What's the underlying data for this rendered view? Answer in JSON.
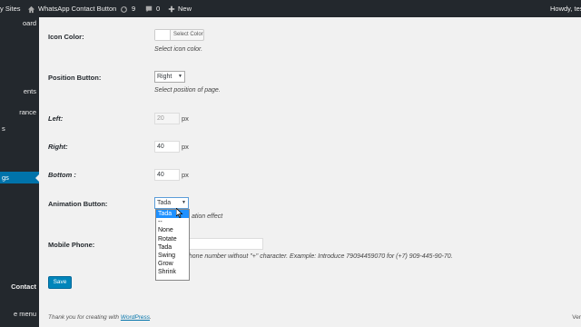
{
  "adminbar": {
    "my_sites": "y Sites",
    "site_name": "WhatsApp Contact Button",
    "updates_count": "9",
    "comments_count": "0",
    "new_label": "New",
    "howdy": "Howdy, test"
  },
  "sidebar": {
    "items": [
      {
        "label": "oard"
      },
      {
        "label": "ents"
      },
      {
        "label": "rance"
      },
      {
        "label": "s"
      },
      {
        "label": "gs"
      },
      {
        "label": "Contact"
      },
      {
        "label": "e menu"
      }
    ]
  },
  "form": {
    "icon_color_label": "Icon Color:",
    "select_color_btn": "Select Color",
    "icon_color_desc": "Select icon color.",
    "position_label": "Position Button:",
    "position_value": "Right",
    "position_desc": "Select position of page.",
    "left_label": "Left:",
    "left_value": "20",
    "right_label": "Right:",
    "right_value": "40",
    "bottom_label": "Bottom :",
    "bottom_value": "40",
    "px": "px",
    "animation_label": "Animation Button:",
    "animation_value": "Tada",
    "animation_desc": "ation effect",
    "animation_options": [
      "Tada",
      "--",
      "None",
      "Rotate",
      "Tada",
      "Swing",
      "Grow",
      "Shrink"
    ],
    "mobile_label": "Mobile Phone:",
    "mobile_desc": "phone number without \"+\" character. Example: Introduce 79094459070 for (+7) 909-445-90-70.",
    "save_label": "Save"
  },
  "footer": {
    "thanks_prefix": "Thank you for creating with",
    "wordpress_link": "WordPress",
    "period": ".",
    "version": "Ver"
  },
  "colors": {
    "admin_dark": "#23282d",
    "accent_blue": "#0073aa",
    "save_blue": "#0085ba",
    "selected_option": "#1e90ff",
    "page_bg": "#f1f1f1"
  }
}
